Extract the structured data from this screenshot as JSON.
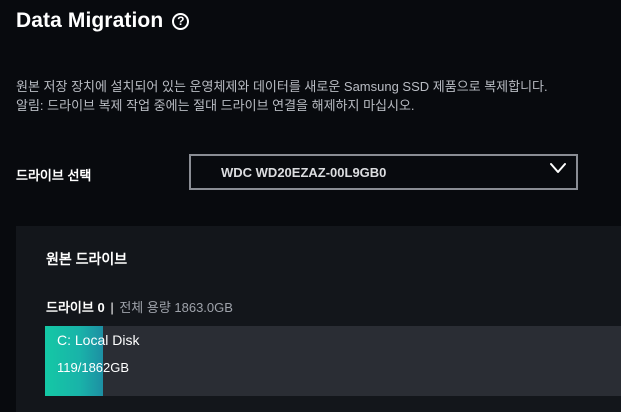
{
  "header": {
    "title": "Data Migration",
    "help_icon": "question-circle-icon"
  },
  "description": {
    "line1": "원본 저장 장치에 설치되어 있는 운영체제와 데이터를 새로운 Samsung SSD 제품으로 복제합니다.",
    "line2": "알림: 드라이브 복제 작업 중에는 절대 드라이브 연결을 해제하지 마십시오."
  },
  "drive_select": {
    "label": "드라이브 선택",
    "selected": "WDC WD20EZAZ-00L9GB0",
    "icon": "chevron-down-icon"
  },
  "source": {
    "title": "원본 드라이브",
    "drive_name": "드라이브 0",
    "separator": "|",
    "total_capacity": "전체 용량 1863.0GB",
    "partition": {
      "name": "C: Local Disk",
      "usage": "119/1862GB",
      "used_fraction": 0.1
    }
  },
  "colors": {
    "background": "#080a0e",
    "panel": "#13161b",
    "accent": "#14c8a5",
    "bar_track": "#2a2d34"
  }
}
